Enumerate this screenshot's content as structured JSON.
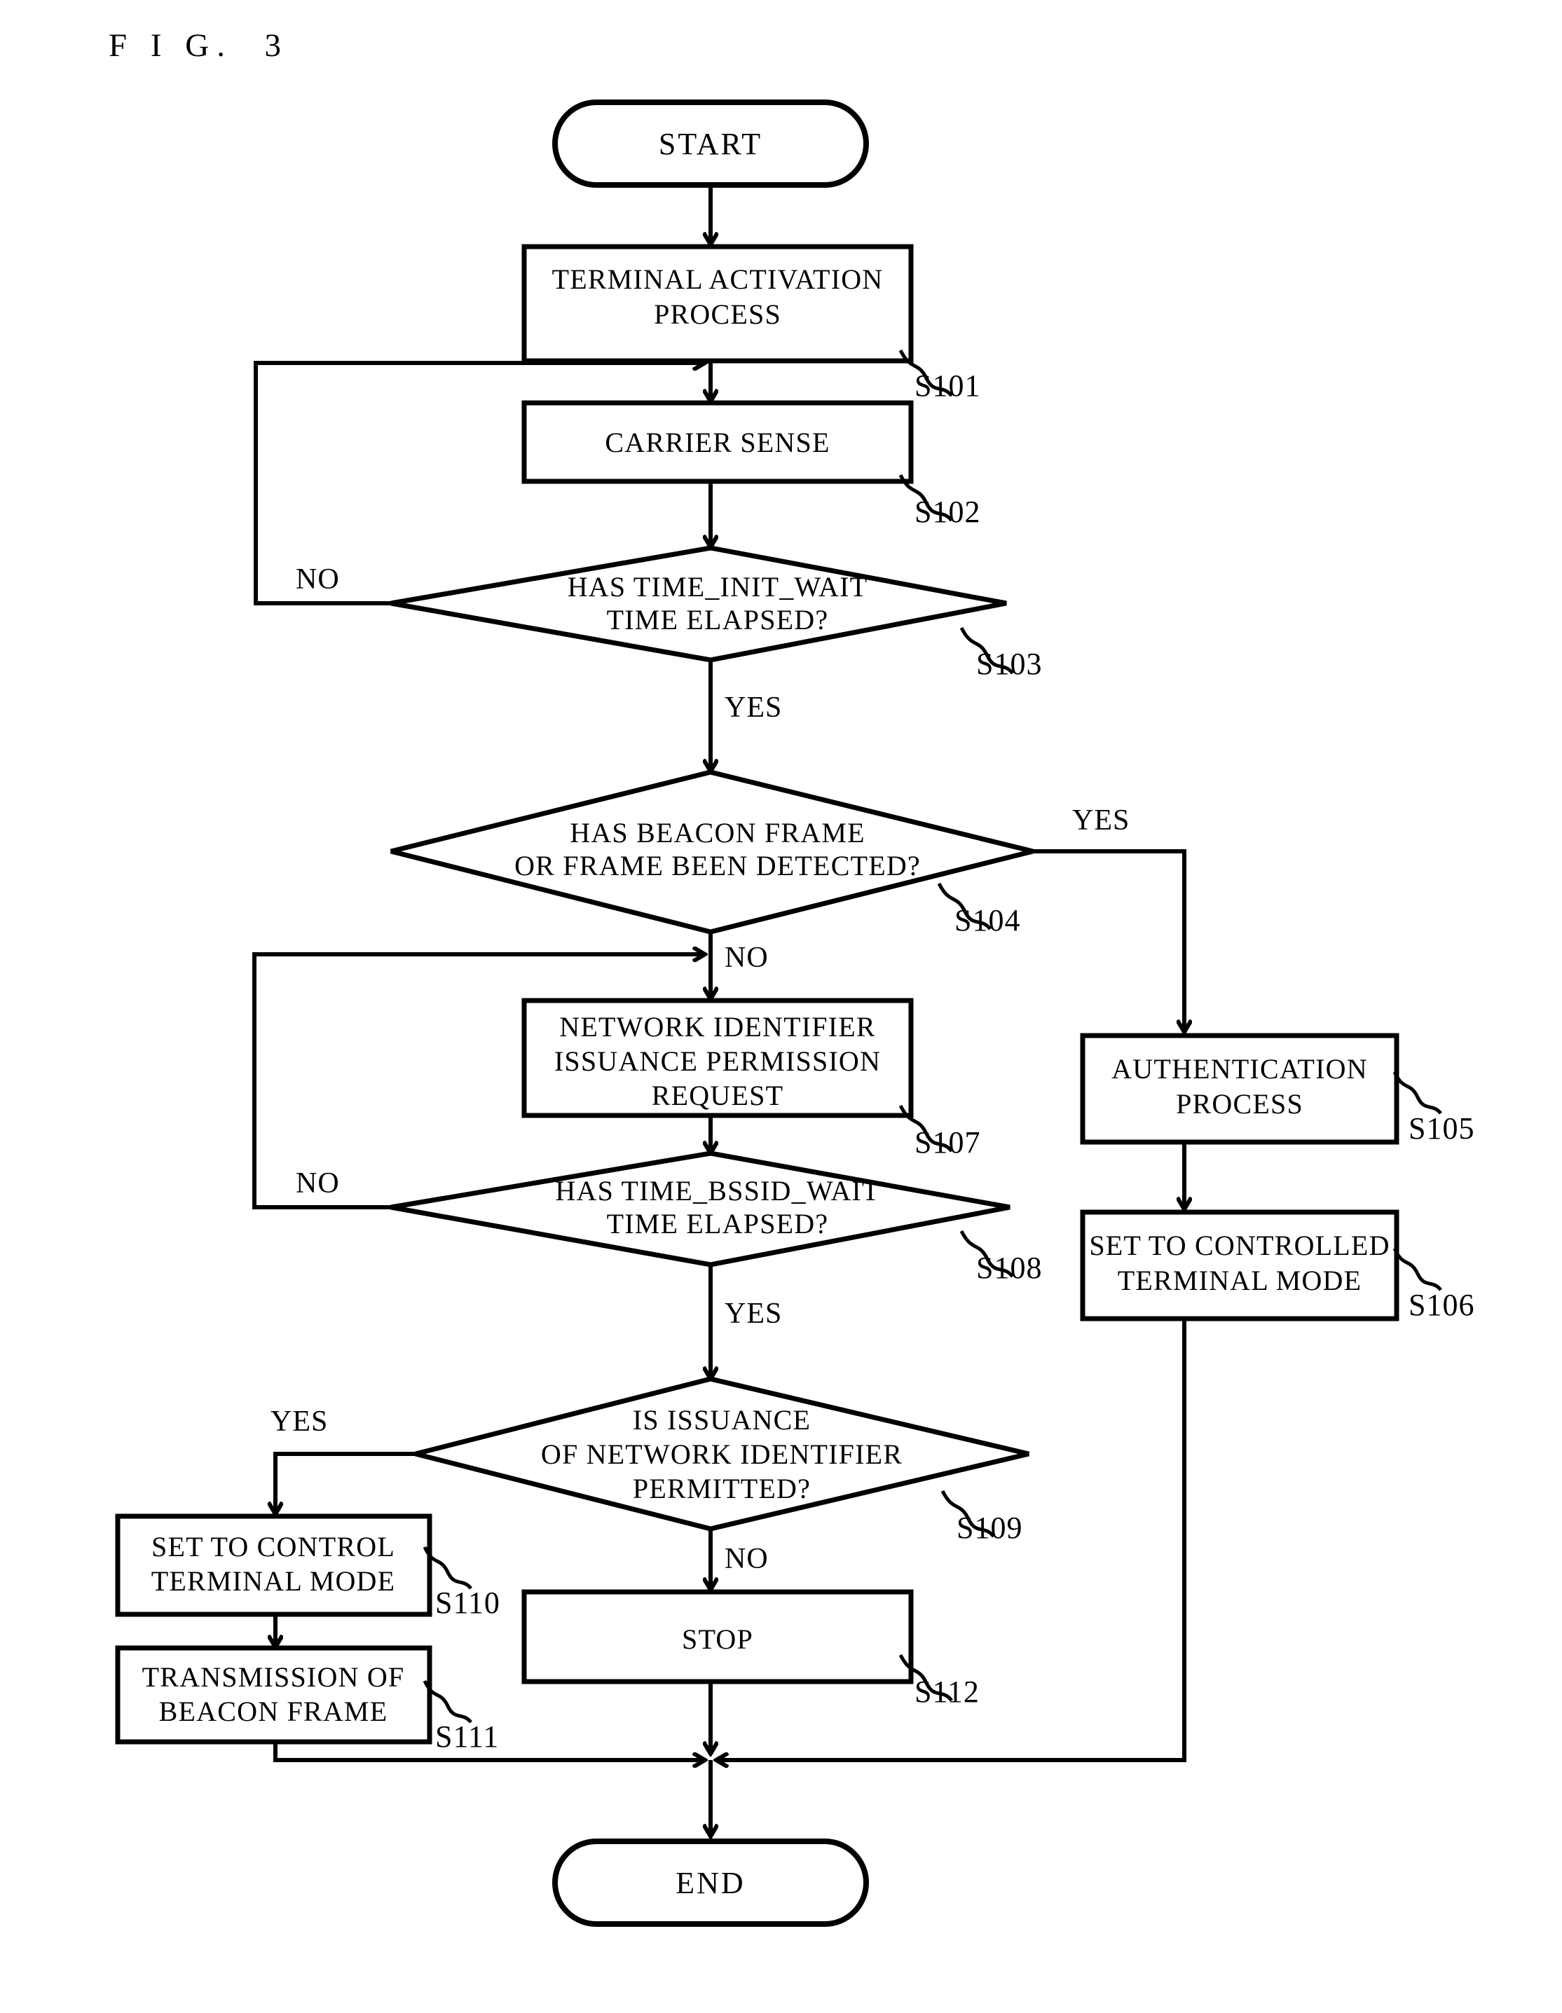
{
  "figure": {
    "title": "F I G.  3"
  },
  "flowchart": {
    "terminals": {
      "start": "START",
      "end": "END"
    },
    "nodes": [
      {
        "id": "s101",
        "step": "S101",
        "type": "process",
        "lines": [
          "TERMINAL ACTIVATION",
          "PROCESS"
        ]
      },
      {
        "id": "s102",
        "step": "S102",
        "type": "process",
        "lines": [
          "CARRIER SENSE"
        ]
      },
      {
        "id": "s103",
        "step": "S103",
        "type": "decision",
        "lines": [
          "HAS TIME_INIT_WAIT",
          "TIME ELAPSED?"
        ]
      },
      {
        "id": "s104",
        "step": "S104",
        "type": "decision",
        "lines": [
          "HAS BEACON FRAME",
          "OR FRAME BEEN DETECTED?"
        ]
      },
      {
        "id": "s105",
        "step": "S105",
        "type": "process",
        "lines": [
          "AUTHENTICATION",
          "PROCESS"
        ]
      },
      {
        "id": "s106",
        "step": "S106",
        "type": "process",
        "lines": [
          "SET TO CONTROLLED",
          "TERMINAL MODE"
        ]
      },
      {
        "id": "s107",
        "step": "S107",
        "type": "process",
        "lines": [
          "NETWORK IDENTIFIER",
          "ISSUANCE PERMISSION",
          "REQUEST"
        ]
      },
      {
        "id": "s108",
        "step": "S108",
        "type": "decision",
        "lines": [
          "HAS TIME_BSSID_WAIT",
          "TIME ELAPSED?"
        ]
      },
      {
        "id": "s109",
        "step": "S109",
        "type": "decision",
        "lines": [
          "IS ISSUANCE",
          "OF NETWORK IDENTIFIER",
          "PERMITTED?"
        ]
      },
      {
        "id": "s110",
        "step": "S110",
        "type": "process",
        "lines": [
          "SET TO CONTROL",
          "TERMINAL MODE"
        ]
      },
      {
        "id": "s111",
        "step": "S111",
        "type": "process",
        "lines": [
          "TRANSMISSION OF",
          "BEACON FRAME"
        ]
      },
      {
        "id": "s112",
        "step": "S112",
        "type": "process",
        "lines": [
          "STOP"
        ]
      }
    ],
    "branch_labels": {
      "s103_no": "NO",
      "s103_yes": "YES",
      "s104_yes": "YES",
      "s104_no": "NO",
      "s108_no": "NO",
      "s108_yes": "YES",
      "s109_yes": "YES",
      "s109_no": "NO"
    },
    "colors": {
      "line": "#000000",
      "fill": "#ffffff",
      "text": "#000000"
    }
  }
}
